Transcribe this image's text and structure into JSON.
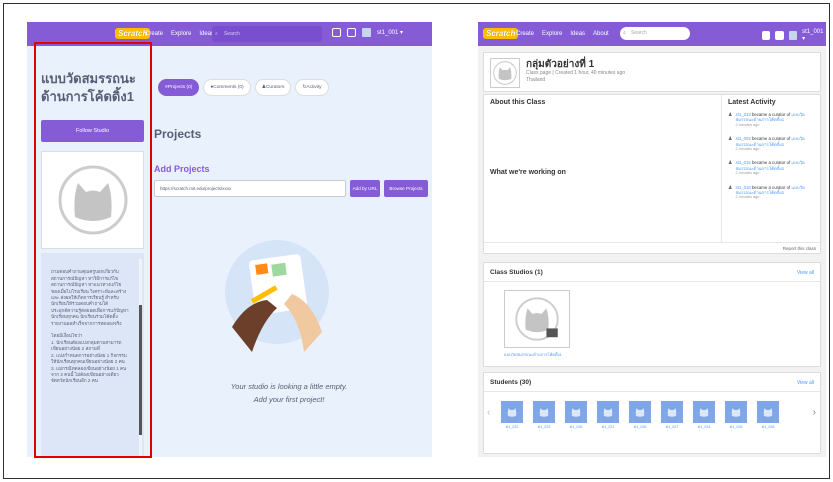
{
  "nav": {
    "create": "Create",
    "explore": "Explore",
    "ideas": "Ideas",
    "about": "About",
    "search_placeholder": "Search",
    "username": "st1_001 ▾",
    "logo": "Scratch"
  },
  "left": {
    "studio_title": "แบบวัดสมรรถนะด้านการโค้ดดิ้ง1",
    "follow": "Follow Studio",
    "description": "ถามตอบคำถามคุณครูบอกเกี่ยวกับ\nสถานการณ์ปัญหา หาวิธีการแก้ไข\nสถานการณ์ปัญหา หาแนวทางแก้ไข\nของเมื่อไปโรงเรียน วิเคราะห์และสร้าง\nและ ส่งผลให้เกิดการเรียนรู้ สำหรับ\nนักเรียนให้ร่วมตอบคำถามได้\nประยุกต์ความรู้ต่อยอดเพื่อการแก้ปัญหา\nนักเรียนทุกคน นักเรียนร่วมโค้ดดิ้ง\nรายงานผลสำเร็จจากการทดลองจริง\n\nโดยมีเงื่อนไขว่า\n1. นักเรียนต้องแบ่งกลุ่มตามสามารถ\nเขียนอย่างน้อย 2 สถานที่\n2. แบ่งกำหนดการอย่างน้อย 1 กิจกรรม\nให้นักเรียนทุกคนเขียนอย่างน้อย 2 คน\n3. แม่กรณีทดลองเขียนอย่างน้อย 1 คน\nจาก 2 คนนี้ ไม่ต้องเขียนอย่างเดียว\nจัดหวัดนักเรียนอีก 2 คน",
    "tabs": [
      "Projects (0)",
      "Comments (0)",
      "Curators",
      "Activity"
    ],
    "projects_heading": "Projects",
    "add_heading": "Add Projects",
    "url_placeholder": "https://scratch.mit.edu/projects/xxxx",
    "add_by_url": "Add by URL",
    "browse": "Browse Projects",
    "empty_line1": "Your studio is looking a little empty.",
    "empty_line2": "Add your first project!"
  },
  "right": {
    "class_title": "กลุ่มตัวอย่างที่ 1",
    "class_sub": "Class page | Created 1 hour, 40 minutes ago",
    "class_loc": "Thailand",
    "about": "About this Class",
    "working": "What we're working on",
    "latest": "Latest Activity",
    "activity": [
      {
        "user": "st1_013",
        "text": "became a curator of",
        "link": "แบบวัดสมรรถนะด้านการโค้ดดิ้ง1",
        "time": "2 minutes ago"
      },
      {
        "user": "st1_002",
        "text": "became a curator of",
        "link": "แบบวัดสมรรถนะด้านการโค้ดดิ้ง1",
        "time": "2 minutes ago"
      },
      {
        "user": "st1_016",
        "text": "became a curator of",
        "link": "แบบวัดสมรรถนะด้านการโค้ดดิ้ง1",
        "time": "2 minutes ago"
      },
      {
        "user": "st1_010",
        "text": "became a curator of",
        "link": "แบบวัดสมรรถนะด้านการโค้ดดิ้ง1",
        "time": "2 minutes ago"
      }
    ],
    "report": "Report this class",
    "studios_h": "Class Studios (1)",
    "view_all": "View all",
    "studio_name": "แบบวัดสมรรถนะด้านการโค้ดดิ้ง1",
    "students_h": "Students (30)",
    "students": [
      "st1_022",
      "st1_023",
      "st1_030",
      "st1_021",
      "st1_026",
      "st1_027",
      "st1_024",
      "st1_025",
      "st1_028"
    ]
  }
}
